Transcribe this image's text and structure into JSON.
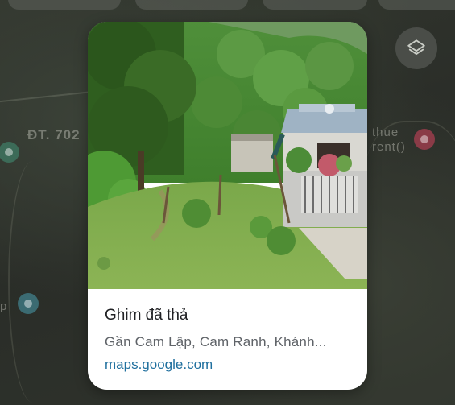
{
  "map": {
    "road_label": "ĐT. 702",
    "poi_label_line1": "thue",
    "poi_label_line2": "rent()",
    "poi_label_left": "p"
  },
  "layers_button": {
    "icon": "layers-icon"
  },
  "preview_card": {
    "title": "Ghim đã thả",
    "subtitle": "Gần Cam Lập, Cam Ranh, Khánh...",
    "link": "maps.google.com"
  },
  "colors": {
    "link": "#1f6f9e",
    "title": "#202124",
    "subtitle": "#5f6368",
    "card_bg": "#ffffff",
    "dim_map": "#2c2f2a"
  }
}
